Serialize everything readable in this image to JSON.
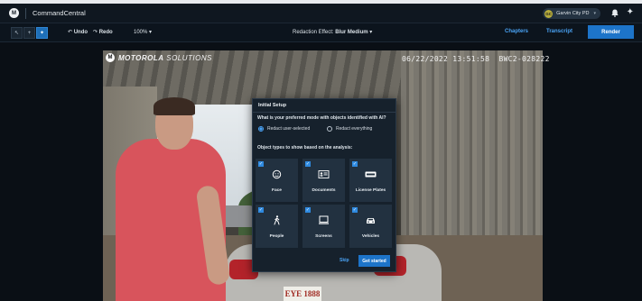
{
  "header": {
    "app_name": "CommandCentral",
    "logo_letter": "M",
    "agency_initials": "GC",
    "agency_name": "Garvin City PD"
  },
  "toolbar": {
    "undo_label": "Undo",
    "redo_label": "Redo",
    "zoom_label": "100%",
    "redaction_label": "Redaction Effect:",
    "redaction_value": "Blur Medium",
    "chapters_label": "Chapters",
    "transcript_label": "Transcript",
    "render_label": "Render"
  },
  "video": {
    "brand_bold": "MOTOROLA",
    "brand_rest": "SOLUTIONS",
    "timestamp": "06/22/2022 13:51:58",
    "device_id": "BWC2-028222",
    "plate_text": "EYE 1888"
  },
  "modal": {
    "title": "Initial Setup",
    "question": "What is your preferred mode with objects identified with AI?",
    "option_selected": "Redact user-selected",
    "option_other": "Redact everything",
    "types_label": "Object types to show based on the analysis:",
    "tiles": [
      {
        "label": "Face",
        "icon": "face-icon",
        "checked": true
      },
      {
        "label": "Documents",
        "icon": "id-card-icon",
        "checked": true
      },
      {
        "label": "License Plates",
        "icon": "license-plate-icon",
        "checked": true
      },
      {
        "label": "People",
        "icon": "person-walking-icon",
        "checked": true
      },
      {
        "label": "Screens",
        "icon": "monitor-icon",
        "checked": true
      },
      {
        "label": "Vehicles",
        "icon": "car-icon",
        "checked": true
      }
    ],
    "skip_label": "Skip",
    "start_label": "Get started"
  },
  "colors": {
    "accent": "#1d74c9",
    "link": "#4aa3f5",
    "topbar": "#0f1720",
    "modal_bg": "#16212c",
    "tile_bg": "#223140"
  }
}
